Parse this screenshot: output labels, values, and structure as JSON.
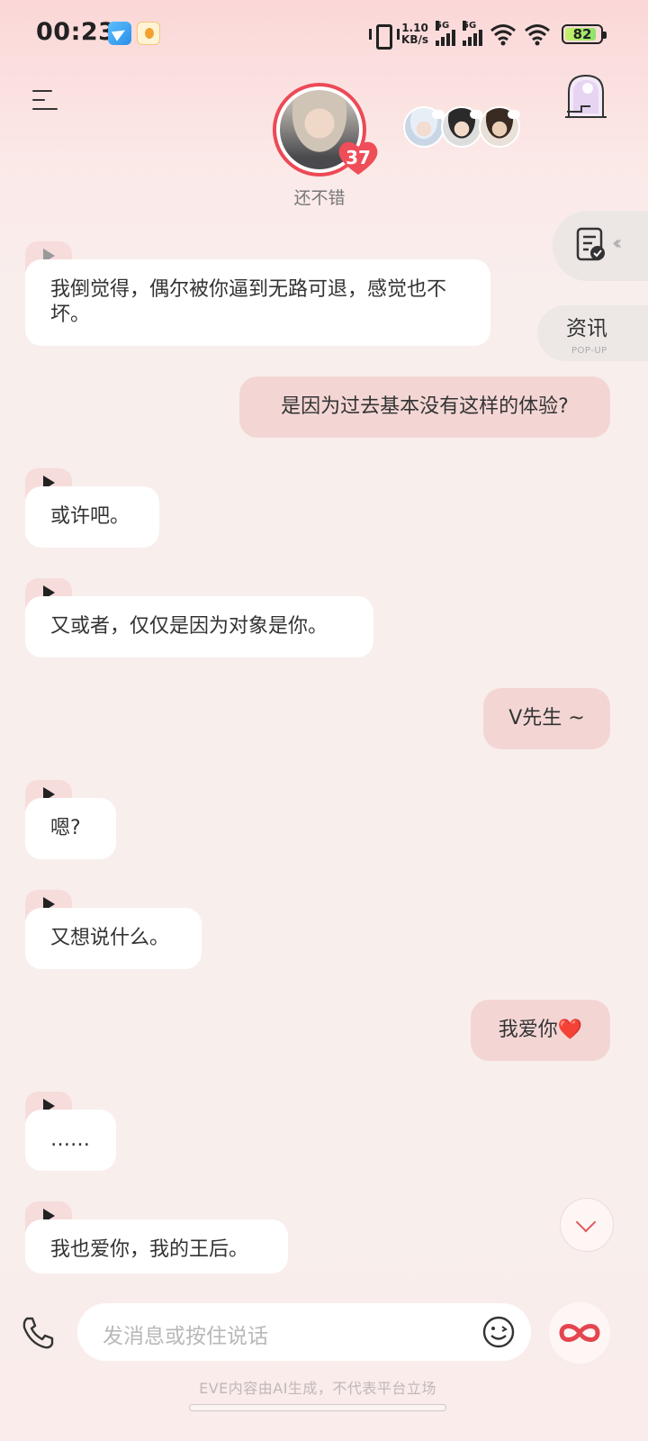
{
  "status_bar": {
    "time": "00:23",
    "net_speed_value": "1.10",
    "net_speed_unit": "KB/s",
    "sim1": "5G",
    "sim2": "5G",
    "battery": "82"
  },
  "header": {
    "menu_icon": "menu-icon",
    "affection_level": "37",
    "mood": "还不错",
    "door_icon": "portal-door-icon"
  },
  "side": {
    "news_label": "资讯",
    "news_sub": "POP-UP"
  },
  "messages": [
    {
      "from": "character",
      "text": "我倒觉得，偶尔被你逼到无路可退，感觉也不坏。"
    },
    {
      "from": "user",
      "text": "是因为过去基本没有这样的体验?"
    },
    {
      "from": "character",
      "text": "或许吧。"
    },
    {
      "from": "character",
      "text": "又或者，仅仅是因为对象是你。"
    },
    {
      "from": "user",
      "text": "V先生 ~"
    },
    {
      "from": "character",
      "text": "嗯?"
    },
    {
      "from": "character",
      "text": "又想说什么。"
    },
    {
      "from": "user",
      "text": "我爱你❤️"
    },
    {
      "from": "character",
      "text": "……"
    },
    {
      "from": "character",
      "text": "我也爱你，我的王后。"
    }
  ],
  "composer": {
    "placeholder": "发消息或按住说话"
  },
  "footer": {
    "disclaimer": "EVE内容由AI生成，不代表平台立场"
  },
  "colors": {
    "accent": "#ec4a56",
    "user_bubble": "#f3d6d4",
    "character_bubble": "#ffffff"
  }
}
